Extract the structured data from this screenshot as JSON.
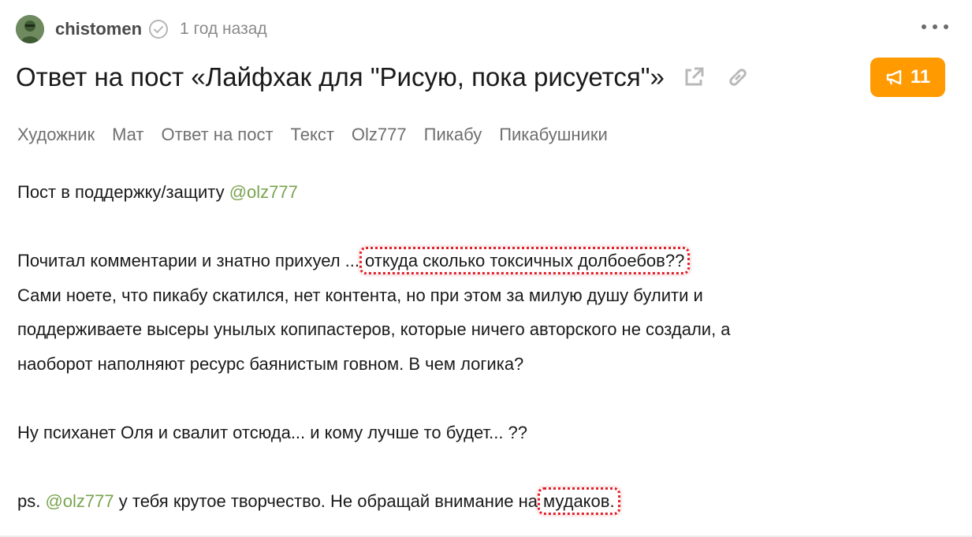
{
  "author": {
    "name": "chistomen",
    "time": "1 год назад",
    "avatar_icon": "soldier-avatar",
    "verified_icon": "check-circle-icon"
  },
  "post": {
    "title": "Ответ на пост «Лайфхак для \"Рисую, пока рисуется\"»",
    "rating": "11",
    "rating_color": "#ff9a00",
    "tags": [
      "Художник",
      "Мат",
      "Ответ на пост",
      "Текст",
      "Olz777",
      "Пикабу",
      "Пикабушники"
    ]
  },
  "body": {
    "p1_text": "Пост в поддержку/защиту ",
    "p1_mention": "@olz777",
    "p2_line1_prefix": "Почитал комментарии и знатно прихуел ...",
    "p2_line1_marked": "откуда сколько токсичных долбоебов??",
    "p2_line2": "Сами ноете, что пикабу скатился, нет контента, но при этом за милую душу булити и",
    "p2_line3": "поддерживаете высеры унылых копипастеров, которые ничего авторского не создали, а",
    "p2_line4": "наоборот наполняют ресурс баянистым говном. В чем логика?",
    "p3_text": "Ну психанет Оля и свалит отсюда... и кому лучше то будет... ??",
    "p4_prefix": "ps. ",
    "p4_mention": "@olz777",
    "p4_middle": " у тебя крутое творчество. Не обращай внимание на",
    "p4_marked": "мудаков."
  },
  "colors": {
    "mention": "#7aa34f",
    "highlight_border": "#e0202a"
  }
}
